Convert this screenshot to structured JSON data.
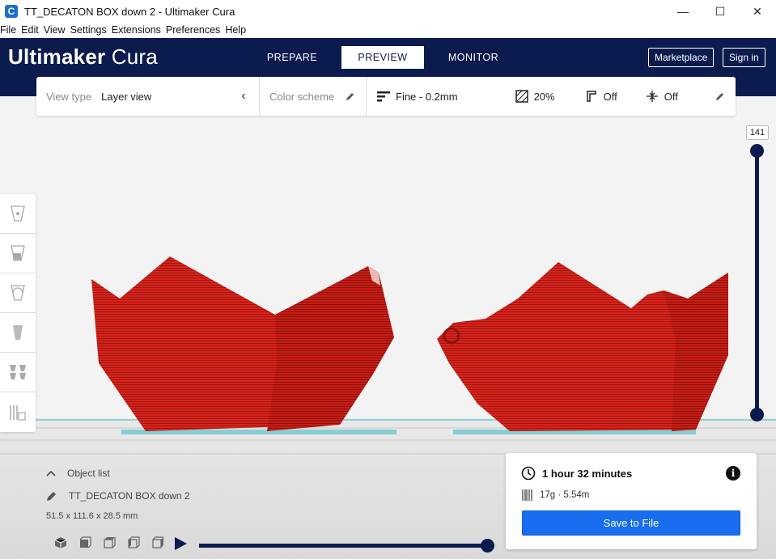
{
  "window": {
    "title": "TT_DECATON BOX down 2 - Ultimaker Cura",
    "app_icon_letter": "C",
    "minimize": "—",
    "maximize": "☐",
    "close": "✕"
  },
  "menu": [
    "File",
    "Edit",
    "View",
    "Settings",
    "Extensions",
    "Preferences",
    "Help"
  ],
  "header": {
    "logo_bold": "Ultimaker",
    "logo_light": " Cura",
    "tabs": [
      {
        "label": "PREPARE",
        "active": false
      },
      {
        "label": "PREVIEW",
        "active": true
      },
      {
        "label": "MONITOR",
        "active": false
      }
    ],
    "marketplace_label": "Marketplace",
    "signin_label": "Sign in"
  },
  "viewbar": {
    "view_type_label": "View type",
    "view_type_value": "Layer view",
    "color_scheme_label": "Color scheme",
    "profile": "Fine - 0.2mm",
    "infill": "20%",
    "support": "Off",
    "adhesion": "Off"
  },
  "layer_slider": {
    "current_layer": "141",
    "upper_level": 1.0,
    "lower_level": 0.0
  },
  "object_list": {
    "header": "Object list",
    "object_name": "TT_DECATON BOX down 2",
    "dimensions": "51.5 x 111.6 x 28.5 mm"
  },
  "playback": {
    "progress": 1.0
  },
  "print_info": {
    "time": "1 hour 32 minutes",
    "info_symbol": "i",
    "material": "17g · 5.54m",
    "save_label": "Save to File"
  },
  "colors": {
    "header_bg": "#0b1b4e",
    "model_red": "#d8231c",
    "save_button": "#196ef0",
    "plate": "#e2e2e2"
  }
}
